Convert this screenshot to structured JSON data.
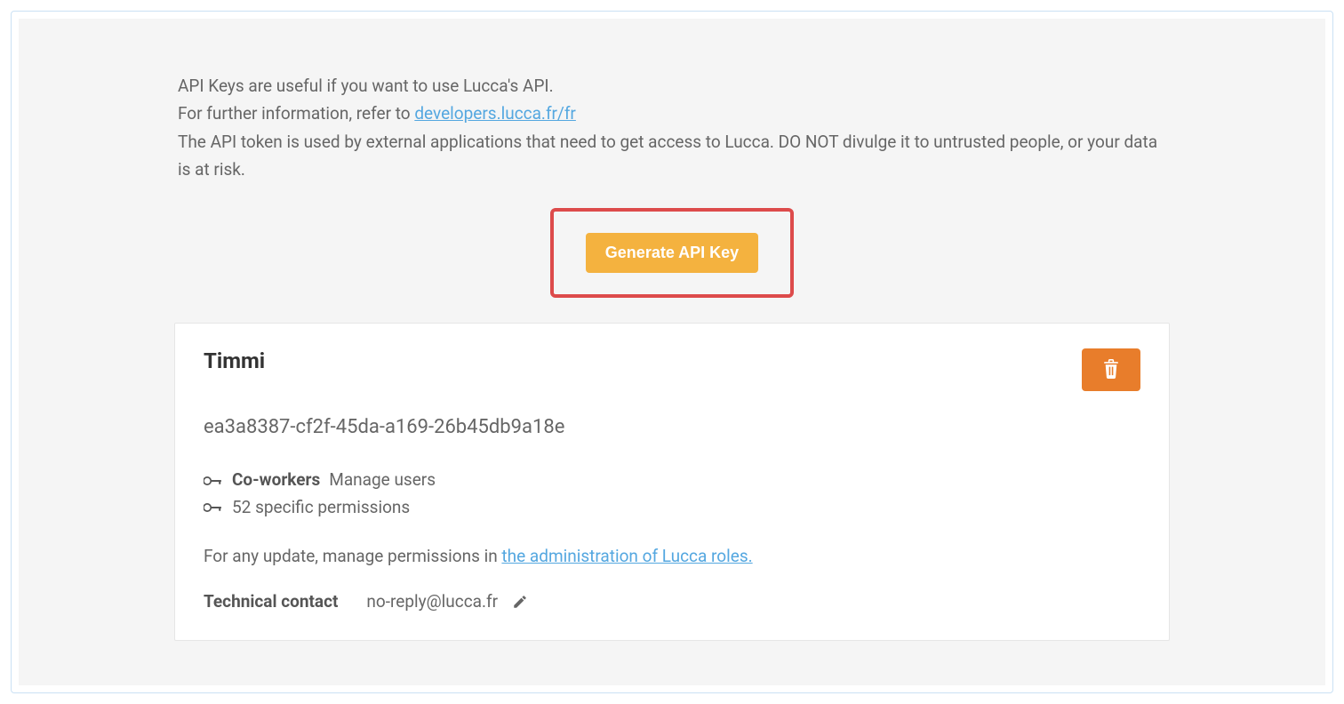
{
  "intro": {
    "line1": "API Keys are useful if you want to use Lucca's API.",
    "line2_prefix": "For further information, refer to ",
    "line2_link": "developers.lucca.fr/fr",
    "line3": "The API token is used by external applications that need to get access to Lucca. DO NOT divulge it to untrusted people, or your data is at risk."
  },
  "buttons": {
    "generate": "Generate API Key"
  },
  "card": {
    "title": "Timmi",
    "token": "ea3a8387-cf2f-45da-a169-26b45db9a18e",
    "permissions": {
      "role_label": "Co-workers",
      "role_desc": "Manage users",
      "specific": "52 specific permissions"
    },
    "update": {
      "prefix": "For any update, manage permissions in ",
      "link": "the administration of Lucca roles."
    },
    "contact": {
      "label": "Technical contact",
      "value": "no-reply@lucca.fr"
    }
  }
}
